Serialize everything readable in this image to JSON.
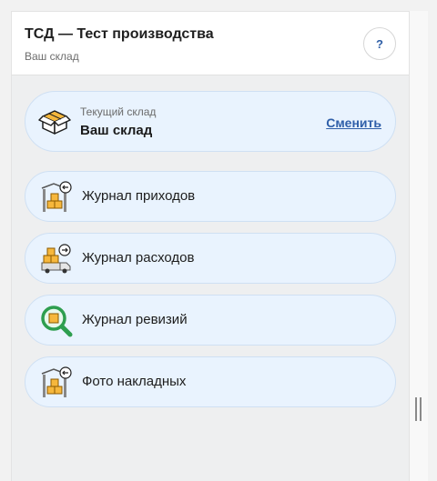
{
  "header": {
    "title": "ТСД — Тест производства",
    "subtitle": "Ваш склад",
    "help_label": "?"
  },
  "warehouse": {
    "label": "Текущий склад",
    "name": "Ваш склад",
    "change_label": "Сменить",
    "icon": "box-open-icon"
  },
  "menu": {
    "items": [
      {
        "label": "Журнал приходов",
        "icon": "warehouse-incoming-icon"
      },
      {
        "label": "Журнал расходов",
        "icon": "truck-outgoing-icon"
      },
      {
        "label": "Журнал ревизий",
        "icon": "magnifier-box-icon"
      },
      {
        "label": "Фото накладных",
        "icon": "warehouse-photo-icon"
      }
    ]
  },
  "colors": {
    "card_bg": "#e9f3fe",
    "accent": "#2f5fa9",
    "box": "#f6b73c"
  }
}
